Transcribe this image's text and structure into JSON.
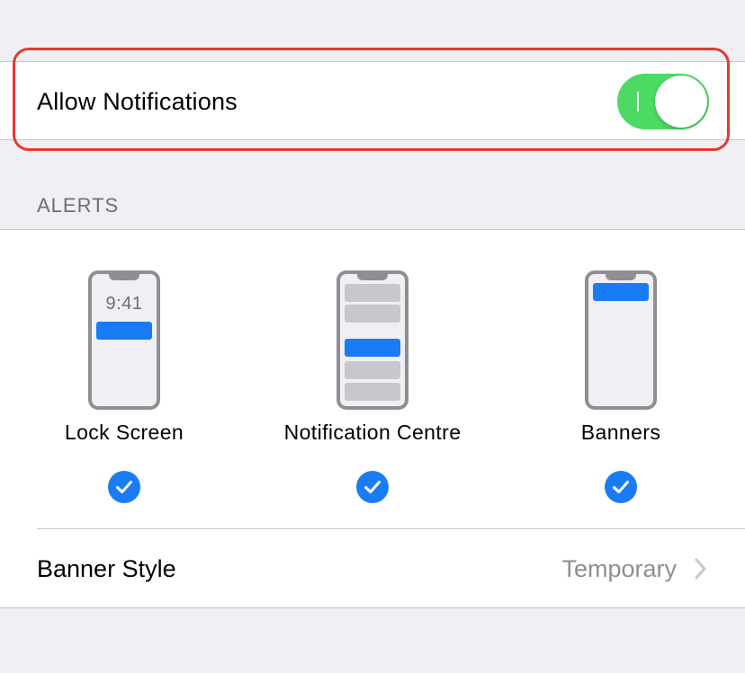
{
  "allow_notifications": {
    "label": "Allow Notifications",
    "toggle_on": true
  },
  "alerts": {
    "header": "ALERTS",
    "options": [
      {
        "label": "Lock Screen",
        "phone_time": "9:41",
        "checked": true
      },
      {
        "label": "Notification Centre",
        "checked": true
      },
      {
        "label": "Banners",
        "checked": true
      }
    ]
  },
  "banner_style": {
    "label": "Banner Style",
    "value": "Temporary"
  },
  "colors": {
    "accent": "#1a7cf5",
    "toggle_green": "#4cd964",
    "highlight": "#e8392b",
    "background": "#efeff4"
  },
  "icons": [
    "checkmark-icon",
    "chevron-right-icon",
    "phone-preview-icon"
  ]
}
